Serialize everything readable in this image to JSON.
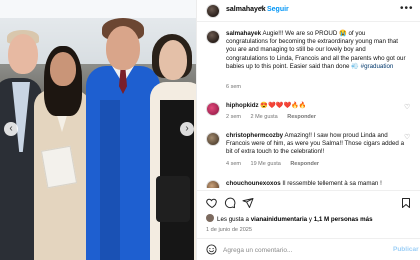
{
  "post": {
    "username": "salmahayek",
    "follow_label": "Seguir",
    "more_label": "•••",
    "dot": "•"
  },
  "caption": {
    "username": "salmahayek",
    "text": "Augie!!! We are so PROUD 😭 of you congratulations for becoming the extraordinary young man that you are and managing to still be our lovely boy and congratulations to Linda, Francois and all the parents who got our babies up to this point. Easier said than done 💨",
    "hashtag": "#graduation",
    "time": "6 sem"
  },
  "comments": [
    {
      "username": "hiphopkidz",
      "text": "😍❤️❤️❤️🔥🔥",
      "time": "2 sem",
      "likes": "2 Me gusta",
      "reply": "Responder"
    },
    {
      "username": "christophermcozby",
      "text": "Amazing!! I saw how proud Linda and Francois were of him, as were you Salma!! Those cigars added a bit of extra touch to the celebration!!",
      "time": "4 sem",
      "likes": "19 Me gusta",
      "reply": "Responder"
    },
    {
      "username": "chouchounexoxos",
      "text": "Il ressemble tellement à sa maman !"
    }
  ],
  "actions": {
    "likes_prefix": "Les gusta a",
    "likes_user": "vianainidumentaria",
    "likes_connector": "y",
    "likes_count": "1,1 M personas más",
    "date": "1 de junio de 2025"
  },
  "add_comment": {
    "placeholder": "Agrega un comentario...",
    "publish_label": "Publicar"
  },
  "icons": {
    "verified": "verified-badge-icon",
    "nav_left": "chevron-left-icon",
    "nav_right": "chevron-right-icon",
    "like": "heart-icon",
    "comment": "comment-icon",
    "share": "share-icon",
    "save": "bookmark-icon",
    "emoji": "emoji-icon"
  }
}
